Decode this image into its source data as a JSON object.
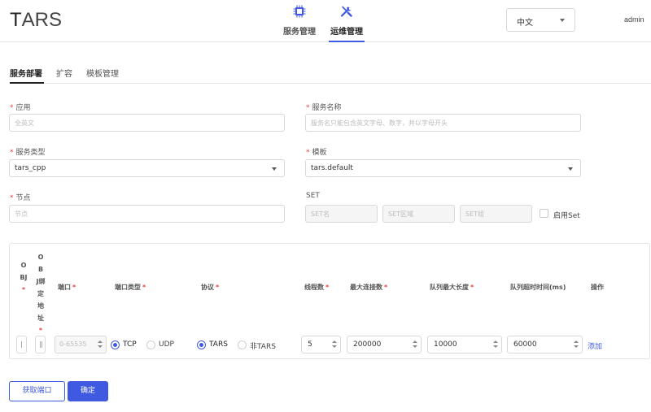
{
  "header": {
    "logo_t": "T",
    "logo_rest": "ARS",
    "nav": [
      {
        "label": "服务管理",
        "icon": "chip-icon"
      },
      {
        "label": "运维管理",
        "icon": "wrench-screwdriver-icon"
      }
    ],
    "language": "中文",
    "user": "admin"
  },
  "tabs": [
    "服务部署",
    "扩容",
    "模板管理"
  ],
  "form": {
    "app_label": "应用",
    "app_placeholder": "全英文",
    "server_name_label": "服务名称",
    "server_name_placeholder": "服务名只能包含英文字母、数字，并以字母开头",
    "server_type_label": "服务类型",
    "server_type_value": "tars_cpp",
    "template_label": "模板",
    "template_value": "tars.default",
    "node_label": "节点",
    "node_placeholder": "节点",
    "set_label": "SET",
    "set_name_placeholder": "SET名",
    "set_area_placeholder": "SET区域",
    "set_group_placeholder": "SET组",
    "enable_set_label": "启用Set"
  },
  "ports": {
    "headers": {
      "obj": "OBJ",
      "obj_bind": "OBJ绑定地址",
      "port": "端口",
      "port_type": "端口类型",
      "protocol": "协议",
      "threads": "线程数",
      "max_conn": "最大连接数",
      "queue_max": "队列最大长度",
      "queue_timeout": "队列超时时间(ms)",
      "action": "操作"
    },
    "row": {
      "port_placeholder": "0-65535",
      "port_type_options": [
        "TCP",
        "UDP"
      ],
      "port_type_selected": "TCP",
      "protocol_options": [
        "TARS",
        "非TARS"
      ],
      "protocol_selected": "TARS",
      "threads": "5",
      "max_conn": "200000",
      "queue_max": "10000",
      "queue_timeout": "60000",
      "add_link": "添加"
    }
  },
  "buttons": {
    "get_port": "获取端口",
    "confirm": "确定"
  },
  "colors": {
    "accent": "#3f5ae0",
    "required": "#e54545"
  }
}
